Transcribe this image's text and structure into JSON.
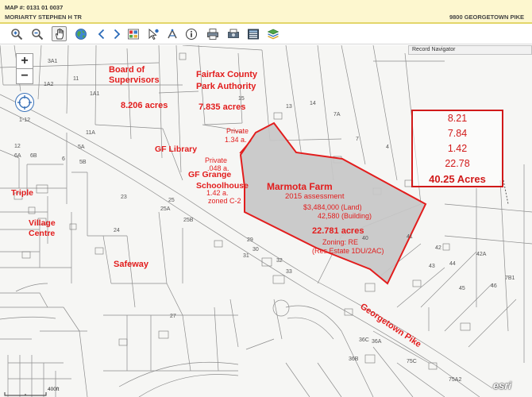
{
  "header": {
    "map_number": "MAP #: 0131 01 0037",
    "owner": "MORIARTY STEPHEN H TR",
    "address": "9800 GEORGETOWN PIKE"
  },
  "toolbar": {
    "buttons": [
      {
        "icon": "zoom-in-icon"
      },
      {
        "icon": "zoom-out-icon"
      },
      {
        "icon": "pan-hand-icon"
      },
      {
        "icon": "globe-icon"
      },
      {
        "icon": "back-arrow-icon"
      },
      {
        "icon": "forward-arrow-icon"
      },
      {
        "icon": "select-parcel-icon"
      },
      {
        "icon": "identify-pointer-icon"
      },
      {
        "icon": "measure-icon"
      },
      {
        "icon": "info-icon"
      },
      {
        "icon": "print-icon"
      },
      {
        "icon": "export-icon"
      },
      {
        "icon": "table-icon"
      },
      {
        "icon": "layers-icon"
      }
    ]
  },
  "record_navigator": "Record Navigator",
  "controls": {
    "zoom_in": "+",
    "zoom_out": "−"
  },
  "annotations": {
    "board": "Board of",
    "board2": "Supervisors",
    "board_acres": "8.206 acres",
    "park": "Fairfax County",
    "park2": "Park Authority",
    "park_acres": "7.835 acres",
    "private1": "Private",
    "private1_acres": "1.34 a.",
    "private2": "Private",
    "private2_acres": ".048 a.",
    "library": "GF Library",
    "grange": "GF Grange",
    "schoolhouse": "Schoolhouse",
    "grange_acres": "1.42 a.",
    "grange_zoned": "zoned C-2",
    "triple": "Triple",
    "village": "Village",
    "centre": "Centre",
    "safeway": "Safeway",
    "farm_title": "Marmota Farm",
    "assessment": "2015 assessment",
    "land": "$3,484,000 (Land)",
    "building": "42,580 (Building)",
    "farm_acres": "22.781 acres",
    "zoning": "Zoning: RE",
    "zoning_detail": "(Res Estate 1DU/2AC)",
    "road": "Georgetown Pike"
  },
  "acres_box": {
    "values": [
      "8.21",
      "7.84",
      "1.42",
      "22.78"
    ],
    "total": "40.25 Acres"
  },
  "parcels": [
    "3A1",
    "1A2",
    "11",
    "1A1",
    "15",
    "13",
    "14",
    "1-12",
    "11A",
    "12",
    "6A",
    "6B",
    "5A",
    "5B",
    "6",
    "23",
    "25A",
    "25",
    "25B",
    "24",
    "29",
    "30",
    "31",
    "32",
    "33",
    "7A",
    "7",
    "4",
    "40",
    "41",
    "42",
    "43",
    "44",
    "45",
    "46",
    "36B",
    "36A",
    "36C",
    "75C",
    "75A2",
    "27",
    "7B1",
    "42A"
  ],
  "scale": "400ft",
  "attribution": "esri",
  "colors": {
    "accent_red": "#e21d1d",
    "header_bg": "#fdf7cf",
    "parcel_fill": "#c8c8c8"
  }
}
